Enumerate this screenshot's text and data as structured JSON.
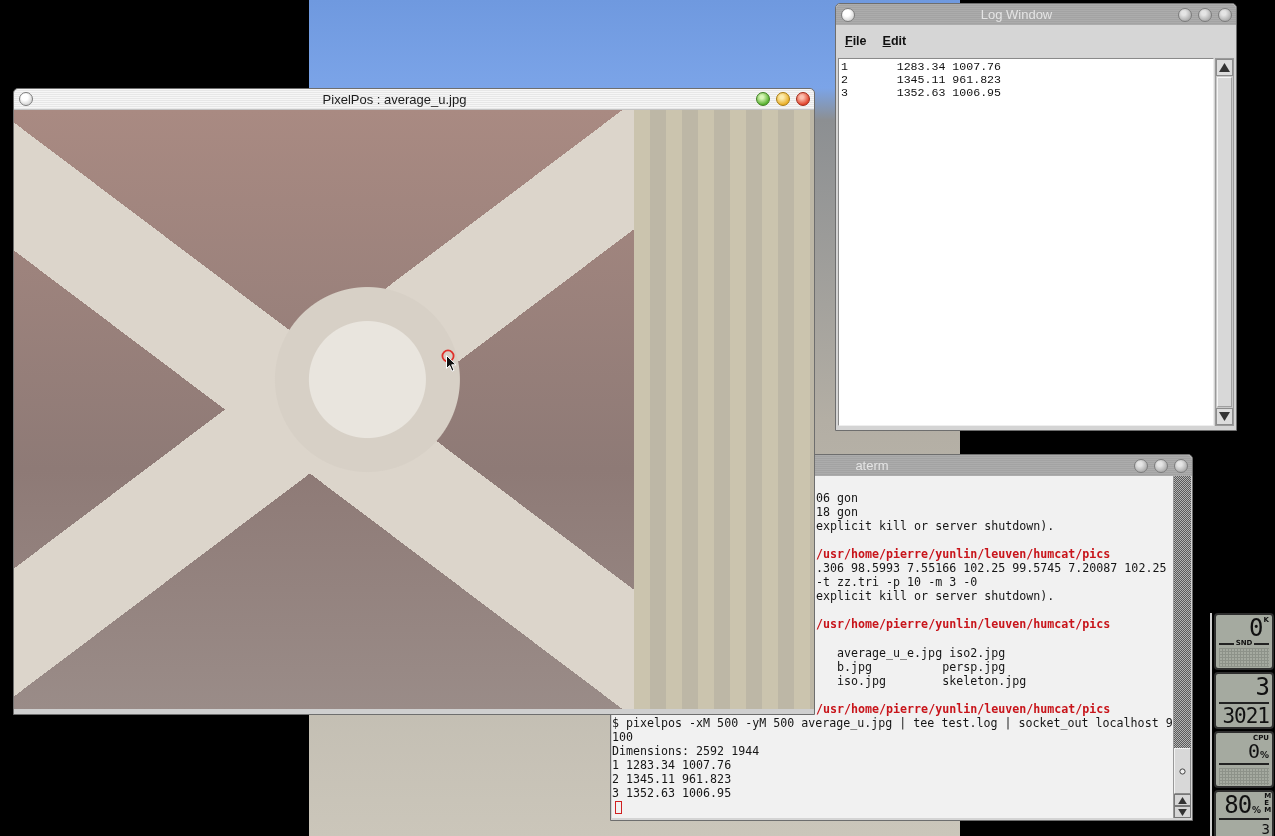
{
  "log_window": {
    "title": "Log Window",
    "active": false,
    "menu": [
      {
        "label": "File"
      },
      {
        "label": "Edit"
      }
    ],
    "lines": [
      "1\t1283.34 1007.76",
      "2\t1345.11 961.823",
      "3\t1352.63 1006.95"
    ]
  },
  "pixelpos_window": {
    "title": "PixelPos : average_u.jpg",
    "active": true
  },
  "terminal_window": {
    "title": "aterm",
    "active": false,
    "blocks": [
      [
        {
          "kind": "output",
          "text": "06 gon"
        },
        {
          "kind": "output",
          "text": "18 gon"
        },
        {
          "kind": "output",
          "text": "explicit kill or server shutdown)."
        }
      ],
      [
        {
          "kind": "path",
          "text": "/usr/home/pierre/yunlin/leuven/humcat/pics"
        },
        {
          "kind": "output",
          "text": ".306 98.5993 7.55166 102.25 99.5745 7.20087 102.25"
        },
        {
          "kind": "output",
          "text": "-t zz.tri -p 10 -m 3 -0"
        },
        {
          "kind": "output",
          "text": "explicit kill or server shutdown)."
        }
      ],
      [
        {
          "kind": "path",
          "text": "/usr/home/pierre/yunlin/leuven/humcat/pics"
        }
      ],
      [
        {
          "kind": "listing",
          "text": "average_u_e.jpg iso2.jpg"
        },
        {
          "kind": "listing",
          "text": "b.jpg          persp.jpg"
        },
        {
          "kind": "listing",
          "text": "iso.jpg        skeleton.jpg"
        }
      ],
      [
        {
          "kind": "path",
          "text": "/usr/home/pierre/yunlin/leuven/humcat/pics"
        },
        {
          "kind": "output",
          "text": "$ pixelpos -xM 500 -yM 500 average_u.jpg | tee test.log | socket_out localhost 9"
        },
        {
          "kind": "output",
          "text": "100"
        },
        {
          "kind": "output",
          "text": "Dimensions: 2592 1944"
        },
        {
          "kind": "output",
          "text": "1 1283.34 1007.76"
        },
        {
          "kind": "output",
          "text": "2 1345.11 961.823"
        },
        {
          "kind": "output",
          "text": "3 1352.63 1006.95"
        }
      ]
    ]
  },
  "monitors": [
    {
      "kind": "sound",
      "value": "0",
      "unit": "K",
      "label": "SND"
    },
    {
      "kind": "clock",
      "value": "3",
      "lower": "3021"
    },
    {
      "kind": "cpu",
      "label": "CPU",
      "value": "0",
      "unit": "%"
    },
    {
      "kind": "memory",
      "label": "MEM",
      "value": "80",
      "unit": "%",
      "lower": "3"
    }
  ]
}
